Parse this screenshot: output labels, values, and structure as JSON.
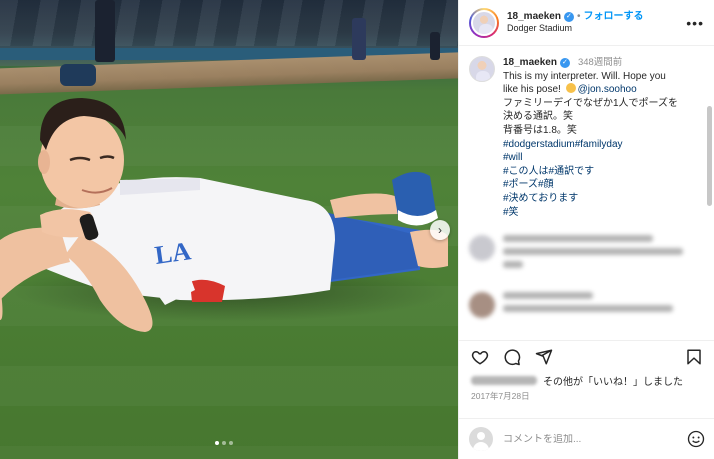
{
  "post": {
    "username": "18_maeken",
    "follow_label": "フォローする",
    "location": "Dodger Stadium",
    "time_ago": "348週間前",
    "caption_lines": [
      "This is my interpreter. Will. Hope you",
      "like his pose! "
    ],
    "mention": "@jon.soohoo",
    "caption_jp": [
      "ファミリーデイでなぜか1人でポーズを",
      "決める通訳。笑",
      "背番号は1.8。笑"
    ],
    "hashtags": [
      "#dodgerstadium#familyday",
      "#will",
      "#この人は#通訳です",
      "#ポーズ#顔",
      "#決めております",
      "#笑"
    ],
    "likes_text": "その他が「いいね！」しました",
    "date": "2017年7月28日",
    "comment_placeholder": "コメントを追加...",
    "jersey_text": "LA"
  },
  "colors": {
    "link": "#00376b",
    "follow": "#0095f6",
    "verified": "#3897f0",
    "jersey_blue": "#3367c6"
  },
  "icons": [
    "verified-badge-icon",
    "more-options-icon",
    "heart-icon",
    "comment-icon",
    "share-icon",
    "bookmark-icon",
    "emoji-icon",
    "next-arrow-icon"
  ]
}
